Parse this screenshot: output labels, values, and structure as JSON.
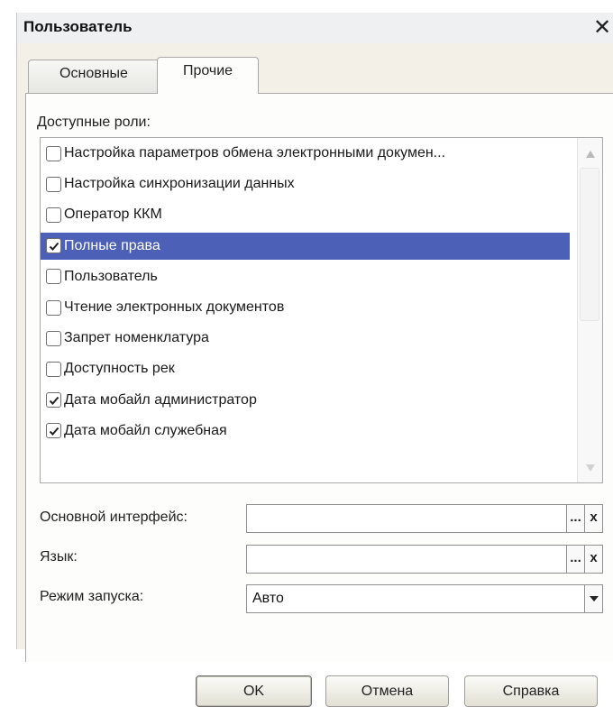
{
  "window": {
    "title": "Пользователь",
    "close_glyph": "✕"
  },
  "tabs": [
    {
      "label": "Основные",
      "active": false
    },
    {
      "label": "Прочие",
      "active": true
    }
  ],
  "roles": {
    "caption": "Доступные роли:",
    "items": [
      {
        "label": "Настройка параметров обмена электронными докумен...",
        "checked": false,
        "selected": false
      },
      {
        "label": "Настройка синхронизации данных",
        "checked": false,
        "selected": false
      },
      {
        "label": "Оператор ККМ",
        "checked": false,
        "selected": false
      },
      {
        "label": "Полные права",
        "checked": true,
        "selected": true
      },
      {
        "label": "Пользователь",
        "checked": false,
        "selected": false
      },
      {
        "label": "Чтение электронных документов",
        "checked": false,
        "selected": false
      },
      {
        "label": "Запрет номенклатура",
        "checked": false,
        "selected": false
      },
      {
        "label": "Доступность рек",
        "checked": false,
        "selected": false
      },
      {
        "label": "Дата мобайл администратор",
        "checked": true,
        "selected": false
      },
      {
        "label": "Дата мобайл служебная",
        "checked": true,
        "selected": false
      }
    ]
  },
  "fields": {
    "interface": {
      "label": "Основной интерфейс:",
      "value": "",
      "select_glyph": "...",
      "clear_glyph": "x"
    },
    "language": {
      "label": "Язык:",
      "value": "",
      "select_glyph": "...",
      "clear_glyph": "x"
    },
    "launch_mode": {
      "label": "Режим запуска:",
      "value": "Авто"
    }
  },
  "buttons": {
    "ok": "OK",
    "cancel": "Отмена",
    "help": "Справка"
  },
  "colors": {
    "selection": "#4c60b8",
    "dialog_background": "#f3f1e7"
  },
  "icons": [
    "close-icon",
    "checkbox-icon",
    "checkmark-icon",
    "scroll-up-icon",
    "scroll-down-icon",
    "dropdown-arrow-icon"
  ]
}
